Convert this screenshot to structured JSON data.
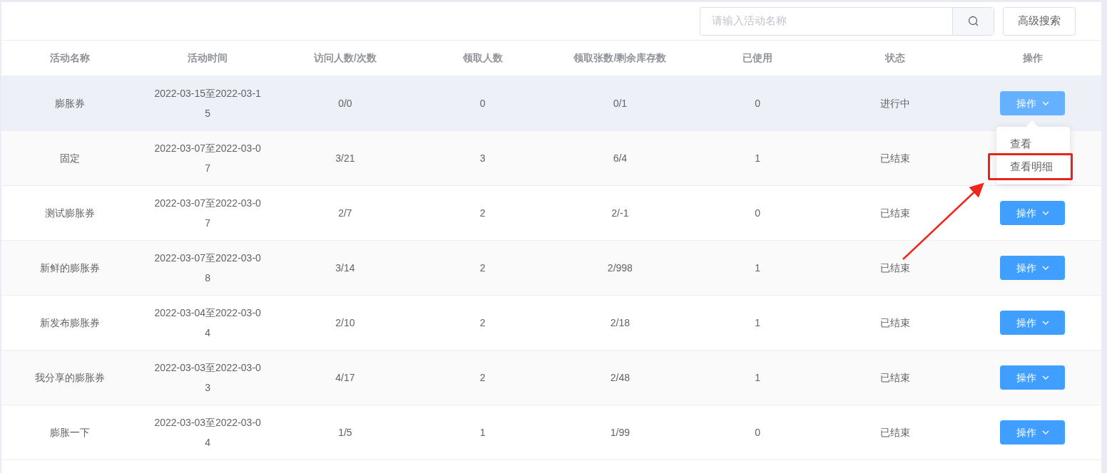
{
  "toolbar": {
    "search": {
      "placeholder": "请输入活动名称"
    },
    "advanced_button": "高级搜索"
  },
  "table": {
    "columns": [
      "活动名称",
      "活动时间",
      "访问人数/次数",
      "领取人数",
      "领取张数/剩余库存数",
      "已使用",
      "状态",
      "操作"
    ],
    "rows": [
      {
        "selected": true,
        "cells": [
          "膨胀券",
          "2022-03-15至2022-03-15",
          "0/0",
          "0",
          "0/1",
          "0",
          "进行中"
        ],
        "action": "操作"
      },
      {
        "selected": false,
        "cells": [
          "固定",
          "2022-03-07至2022-03-07",
          "3/21",
          "3",
          "6/4",
          "1",
          "已结束"
        ]
      },
      {
        "selected": false,
        "cells": [
          "测试膨胀券",
          "2022-03-07至2022-03-07",
          "2/7",
          "2",
          "2/-1",
          "0",
          "已结束"
        ],
        "action": "操作"
      },
      {
        "selected": false,
        "cells": [
          "新鲜的膨胀券",
          "2022-03-07至2022-03-08",
          "3/14",
          "2",
          "2/998",
          "1",
          "已结束"
        ],
        "action": "操作"
      },
      {
        "selected": false,
        "cells": [
          "新发布膨胀券",
          "2022-03-04至2022-03-04",
          "2/10",
          "2",
          "2/18",
          "1",
          "已结束"
        ],
        "action": "操作"
      },
      {
        "selected": false,
        "cells": [
          "我分享的膨胀券",
          "2022-03-03至2022-03-03",
          "4/17",
          "2",
          "2/48",
          "1",
          "已结束"
        ],
        "action": "操作"
      },
      {
        "selected": false,
        "cells": [
          "膨胀一下",
          "2022-03-03至2022-03-04",
          "1/5",
          "1",
          "1/99",
          "0",
          "已结束"
        ],
        "action": "操作"
      }
    ]
  },
  "dropdown": {
    "items": [
      {
        "label": "查看",
        "highlighted": false
      },
      {
        "label": "查看明细",
        "highlighted": true
      }
    ]
  }
}
